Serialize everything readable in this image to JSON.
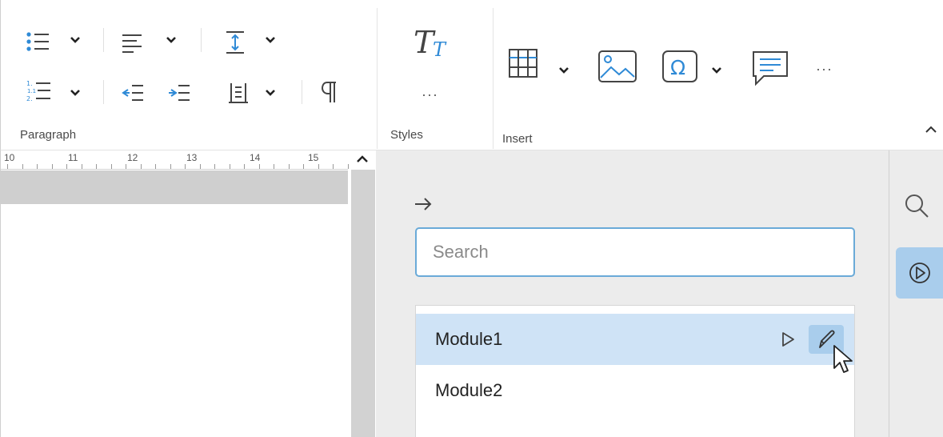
{
  "ribbon": {
    "groups": {
      "paragraph": "Paragraph",
      "styles": "Styles",
      "insert": "Insert"
    },
    "paragraph_icons": [
      "bulleted-list-icon",
      "alignment-icon",
      "line-spacing-icon",
      "numbered-list-icon",
      "decrease-indent-icon",
      "increase-indent-icon",
      "paragraph-spacing-icon",
      "pilcrow-icon"
    ],
    "styles_icons": [
      "text-styles-icon",
      "more-styles-icon"
    ],
    "insert_icons": [
      "table-icon",
      "image-icon",
      "special-character-icon",
      "comment-icon",
      "more-insert-icon"
    ],
    "more_glyph": "···"
  },
  "ruler": {
    "numbers": [
      "10",
      "11",
      "12",
      "13",
      "14",
      "15"
    ]
  },
  "panel": {
    "search": {
      "placeholder": "Search",
      "value": ""
    },
    "modules": [
      {
        "name": "Module1",
        "selected": true
      },
      {
        "name": "Module2",
        "selected": false
      }
    ]
  },
  "colors": {
    "accent": "#2f8ad6",
    "selection": "#cfe3f6",
    "active_button": "#a9cdec",
    "panel_bg": "#ececec"
  }
}
